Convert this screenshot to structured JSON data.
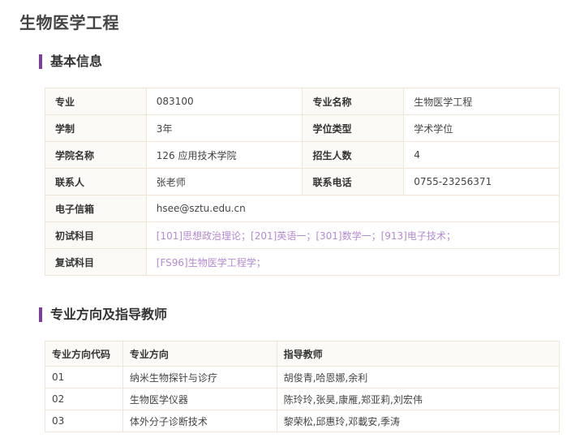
{
  "page_title": "生物医学工程",
  "basic_info": {
    "section_title": "基本信息",
    "major_label": "专业",
    "major_code": "083100",
    "major_name_label": "专业名称",
    "major_name": "生物医学工程",
    "duration_label": "学制",
    "duration": "3年",
    "degree_type_label": "学位类型",
    "degree_type": "学术学位",
    "college_label": "学院名称",
    "college": "126 应用技术学院",
    "enrollment_label": "招生人数",
    "enrollment": "4",
    "contact_label": "联系人",
    "contact": "张老师",
    "phone_label": "联系电话",
    "phone": "0755-23256371",
    "email_label": "电子信箱",
    "email": "hsee@sztu.edu.cn",
    "initial_exam_label": "初试科目",
    "initial_exam": "[101]思想政治理论；[201]英语一；[301]数学一；[913]电子技术；",
    "retest_label": "复试科目",
    "retest": "[FS96]生物医学工程学；"
  },
  "directions": {
    "section_title": "专业方向及指导教师",
    "headers": [
      "专业方向代码",
      "专业方向",
      "指导教师"
    ],
    "rows": [
      {
        "code": "01",
        "direction": "纳米生物探针与诊疗",
        "advisors": "胡俊青,哈恩娜,余利"
      },
      {
        "code": "02",
        "direction": "生物医学仪器",
        "advisors": "陈玲玲,张昊,康雁,郑亚莉,刘宏伟"
      },
      {
        "code": "03",
        "direction": "体外分子诊断技术",
        "advisors": "黎荣松,邱惠玲,邓載安,季涛"
      }
    ]
  }
}
